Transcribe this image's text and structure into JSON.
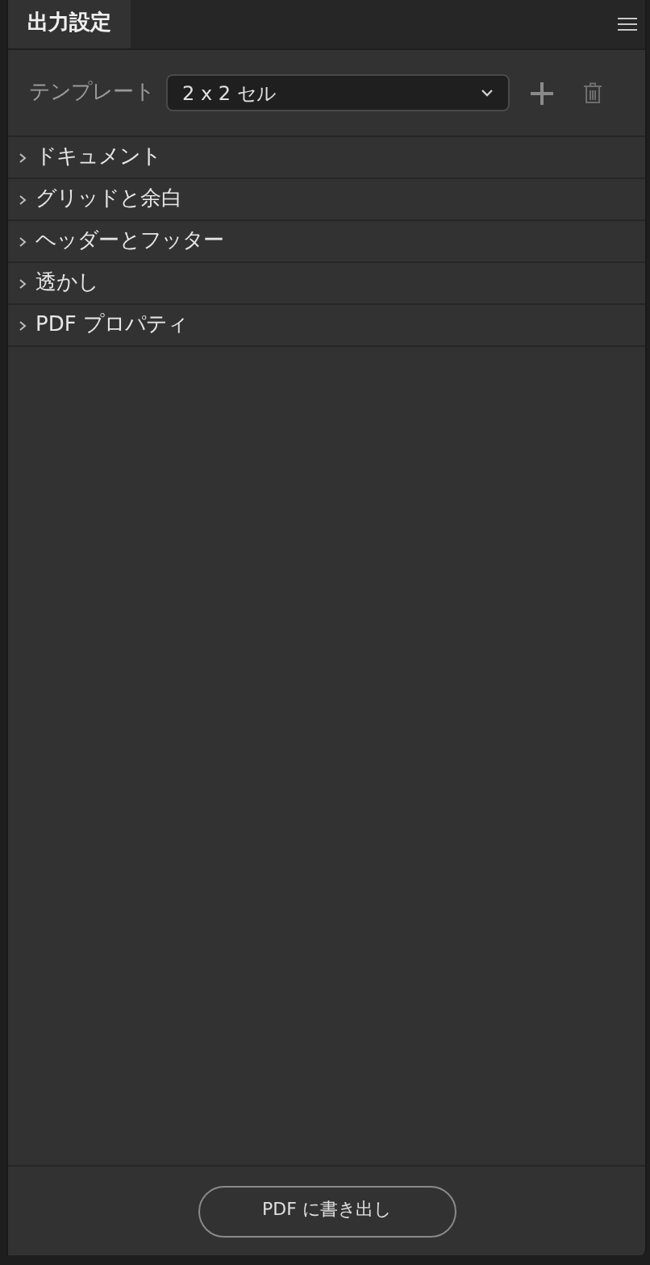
{
  "tabs": [
    {
      "label": "出力設定",
      "selected": true
    }
  ],
  "template": {
    "label": "テンプレート",
    "value": "2 x 2 セル"
  },
  "sections": [
    {
      "label": "ドキュメント",
      "expanded": false
    },
    {
      "label": "グリッドと余白",
      "expanded": false
    },
    {
      "label": "ヘッダーとフッター",
      "expanded": false
    },
    {
      "label": "透かし",
      "expanded": false
    },
    {
      "label": "PDF プロパティ",
      "expanded": false
    }
  ],
  "export_button": "PDF に書き出し"
}
